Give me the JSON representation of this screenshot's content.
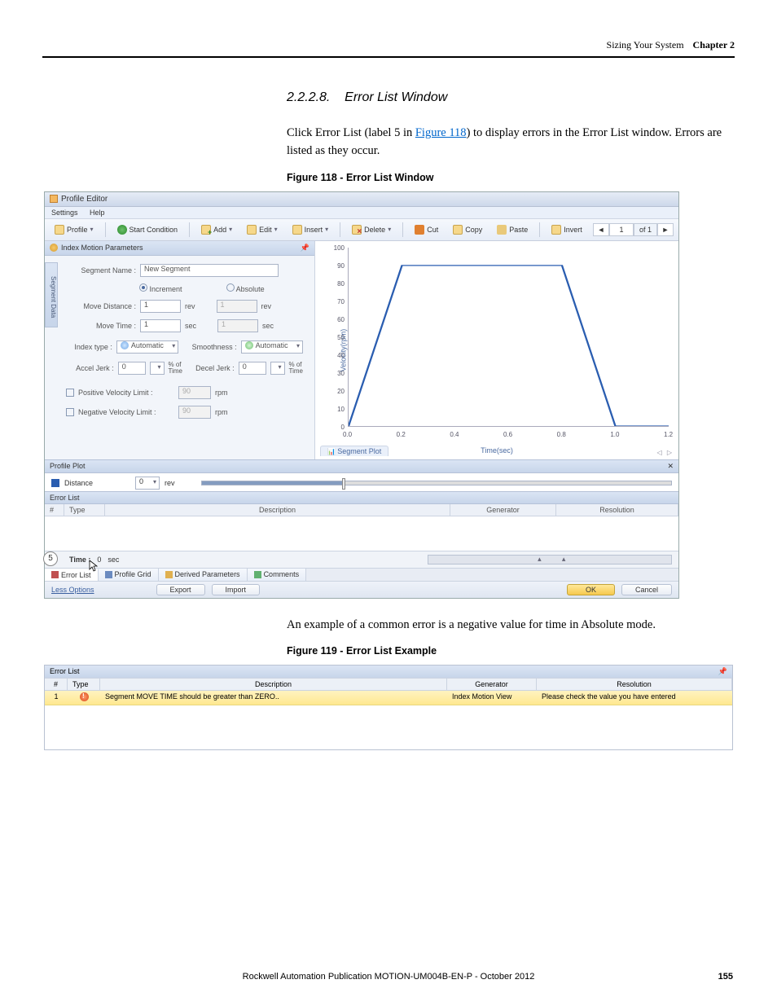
{
  "header": {
    "section": "Sizing Your System",
    "chapter": "Chapter 2"
  },
  "heading": {
    "number": "2.2.2.8.",
    "title": "Error List Window"
  },
  "para1_a": "Click Error List (label 5 in ",
  "para1_link": "Figure 118",
  "para1_b": ") to display errors in the Error List window. Errors are listed as they occur.",
  "fig118_caption": "Figure 118 - Error List Window",
  "para2": "An example of a common error is a negative value for time in Absolute mode.",
  "fig119_caption": "Figure 119 - Error List Example",
  "footer": {
    "pub": "Rockwell Automation Publication MOTION-UM004B-EN-P - October 2012",
    "page": "155"
  },
  "pe": {
    "title": "Profile Editor",
    "menu": {
      "settings": "Settings",
      "help": "Help"
    },
    "toolbar": {
      "profile": "Profile",
      "start": "Start Condition",
      "add": "Add",
      "edit": "Edit",
      "insert": "Insert",
      "delete": "Delete",
      "cut": "Cut",
      "copy": "Copy",
      "paste": "Paste",
      "invert": "Invert",
      "nav": {
        "prev": "◄",
        "cur": "1",
        "of": "of 1",
        "next": "►"
      }
    },
    "panel_title": "Index Motion Parameters",
    "sidebar_tab": "Segment Data",
    "form": {
      "segment_name_label": "Segment Name :",
      "segment_name_value": "New Segment",
      "increment": "Increment",
      "absolute": "Absolute",
      "move_distance_label": "Move Distance :",
      "move_distance_value": "1",
      "unit_rev": "rev",
      "abs_dist_value": "1",
      "move_time_label": "Move Time :",
      "move_time_value": "1",
      "unit_sec": "sec",
      "abs_time_value": "1",
      "index_type_label": "Index type :",
      "automatic": "Automatic",
      "smoothness_label": "Smoothness :",
      "accel_jerk_label": "Accel Jerk :",
      "accel_jerk_value": "0",
      "pct_time": "% of\nTime",
      "decel_jerk_label": "Decel Jerk :",
      "decel_jerk_value": "0",
      "pos_vel_label": "Positive Velocity Limit :",
      "pos_vel_value": "90",
      "neg_vel_label": "Negative Velocity Limit :",
      "neg_vel_value": "90",
      "unit_rpm": "rpm"
    },
    "chart": {
      "ylabel": "Velocity(rpm)",
      "xlabel": "Time(sec)",
      "segment_tab": "Segment Plot",
      "seg_nav": "◁ ▷"
    },
    "profile_plot": {
      "title": "Profile Plot",
      "legend": "Distance",
      "val": "0",
      "unit": "rev",
      "pin": "✕"
    },
    "error_list": {
      "title": "Error List",
      "cols": {
        "num": "#",
        "type": "Type",
        "desc": "Description",
        "gen": "Generator",
        "res": "Resolution"
      }
    },
    "time_bar": {
      "label": "Time :",
      "value": "0",
      "unit": "sec",
      "callout": "5"
    },
    "tabs": {
      "error_list": "Error List",
      "profile_grid": "Profile Grid",
      "derived": "Derived Parameters",
      "comments": "Comments"
    },
    "status": {
      "less": "Less Options",
      "export": "Export",
      "import": "Import",
      "ok": "OK",
      "cancel": "Cancel"
    }
  },
  "el": {
    "title": "Error List",
    "cols": {
      "num": "#",
      "type": "Type",
      "desc": "Description",
      "gen": "Generator",
      "res": "Resolution"
    },
    "row": {
      "num": "1",
      "desc": "Segment MOVE TIME should be greater than ZERO..",
      "gen": "Index Motion View",
      "res": "Please check the value you have entered"
    },
    "pin": "📌"
  },
  "chart_data": {
    "type": "line",
    "x": [
      0.0,
      0.2,
      0.8,
      1.0,
      1.2
    ],
    "y": [
      0,
      90,
      90,
      0,
      0
    ],
    "xlabel": "Time(sec)",
    "ylabel": "Velocity(rpm)",
    "ylim": [
      0,
      100
    ],
    "xlim": [
      0.0,
      1.2
    ],
    "yticks": [
      0,
      10,
      20,
      30,
      40,
      50,
      60,
      70,
      80,
      90,
      100
    ],
    "xticks": [
      0.0,
      0.2,
      0.4,
      0.6,
      0.8,
      1.0,
      1.2
    ]
  }
}
